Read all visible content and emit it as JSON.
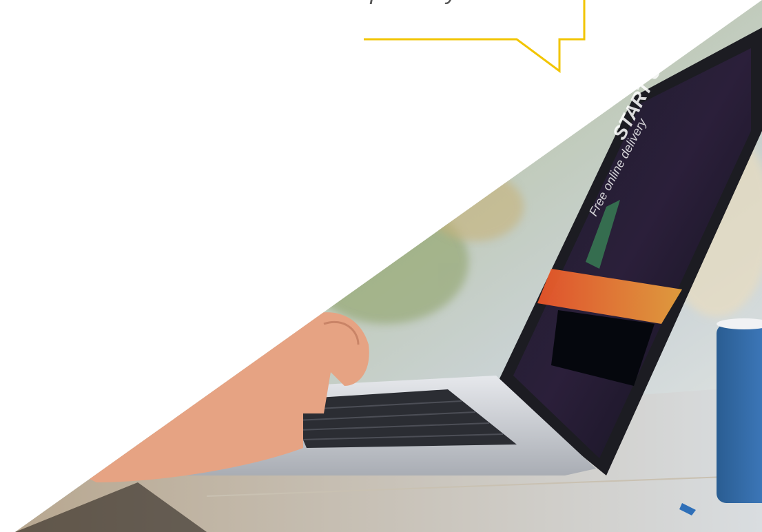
{
  "caption": {
    "text": "and adapted to your needs."
  },
  "laptop_screen": {
    "headline": "START UP",
    "subline": "Free online delivery"
  },
  "colors": {
    "background": "#ffffff",
    "bubble_outline": "#f2c500",
    "caption_text": "#555555"
  }
}
